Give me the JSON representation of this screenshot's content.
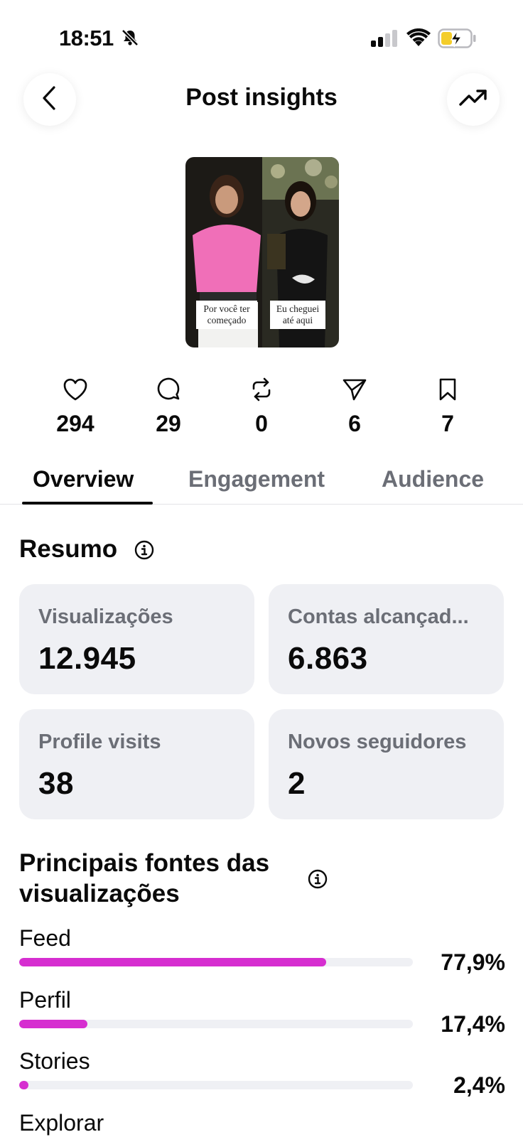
{
  "status_bar": {
    "time": "18:51"
  },
  "header": {
    "title": "Post insights"
  },
  "post": {
    "caption_left": "Por você ter começado",
    "caption_right": "Eu cheguei até aqui"
  },
  "stats": [
    {
      "icon": "heart-icon",
      "value": "294"
    },
    {
      "icon": "comment-icon",
      "value": "29"
    },
    {
      "icon": "repost-icon",
      "value": "0"
    },
    {
      "icon": "share-icon",
      "value": "6"
    },
    {
      "icon": "bookmark-icon",
      "value": "7"
    }
  ],
  "tabs": [
    {
      "label": "Overview",
      "active": true
    },
    {
      "label": "Engagement",
      "active": false
    },
    {
      "label": "Audience",
      "active": false
    }
  ],
  "summary": {
    "title": "Resumo",
    "cards": [
      {
        "label": "Visualizações",
        "value": "12.945"
      },
      {
        "label": "Contas alcançad...",
        "value": "6.863"
      },
      {
        "label": "Profile visits",
        "value": "38"
      },
      {
        "label": "Novos seguidores",
        "value": "2"
      }
    ]
  },
  "sources": {
    "title": "Principais fontes das visualizações",
    "items": [
      {
        "name": "Feed",
        "percent": "77,9%",
        "fraction": 0.779
      },
      {
        "name": "Perfil",
        "percent": "17,4%",
        "fraction": 0.174
      },
      {
        "name": "Stories",
        "percent": "2,4%",
        "fraction": 0.024
      },
      {
        "name": "Explorar",
        "percent": "",
        "fraction": 0
      }
    ]
  },
  "colors": {
    "accent": "#d62ed0",
    "card_bg": "#eff0f4",
    "muted_text": "#6b6e76"
  }
}
